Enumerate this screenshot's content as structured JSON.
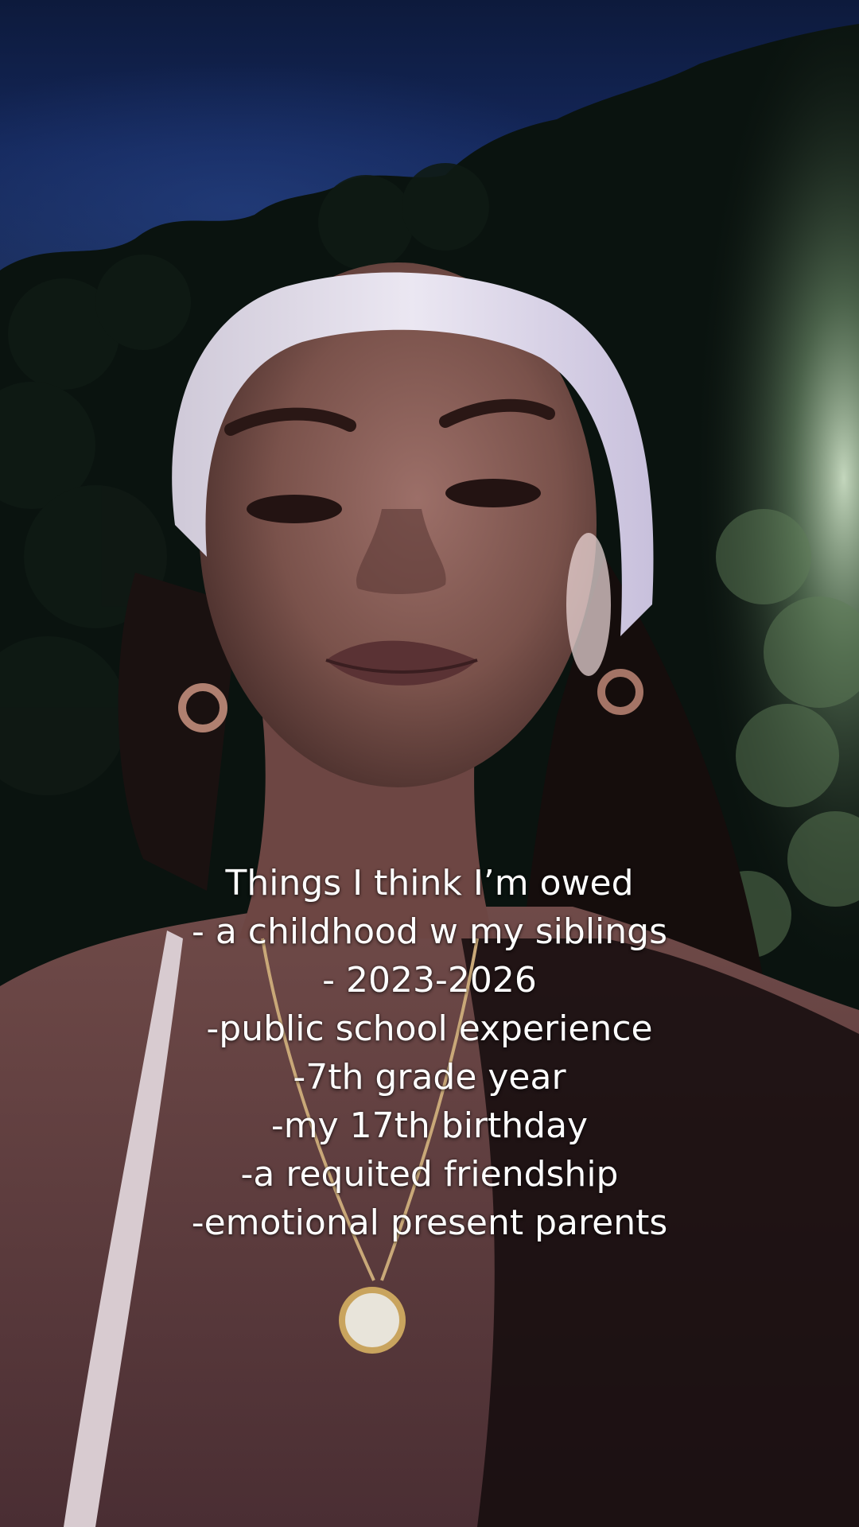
{
  "caption": {
    "lines": [
      "Things I think I’m owed",
      "- a childhood w my siblings",
      "- 2023-2026",
      "-public school experience",
      "-7th grade year",
      "-my 17th birthday",
      "-a requited friendship",
      "-emotional present parents"
    ]
  },
  "colors": {
    "sky": "#14275a",
    "foliage": "#0c140f",
    "skin": "#7a5048",
    "headband": "#d9d4e4",
    "text": "#ffffff"
  }
}
